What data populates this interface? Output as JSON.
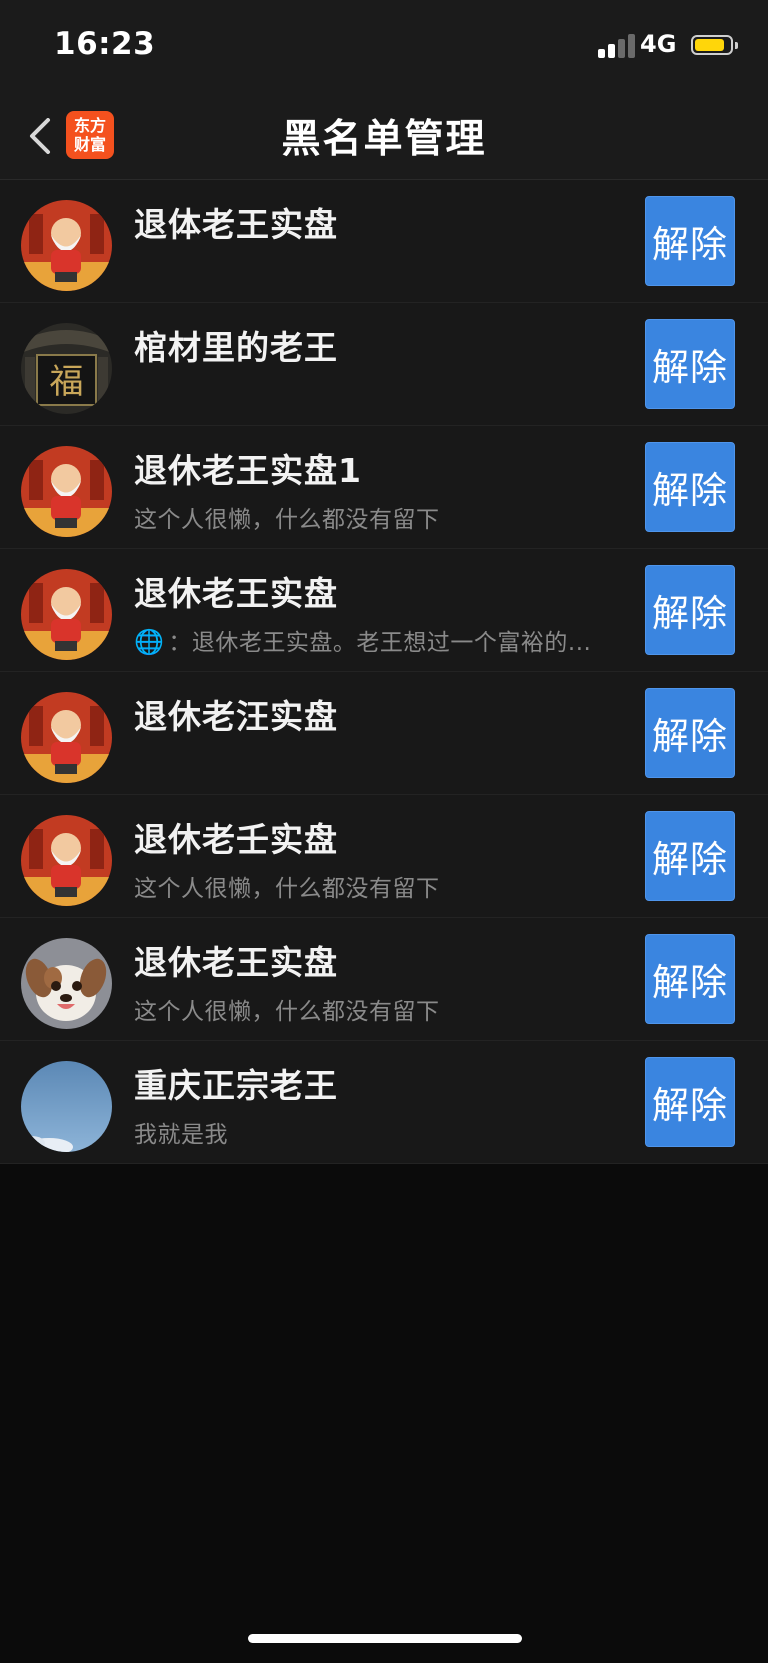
{
  "status_bar": {
    "time": "16:23",
    "network": "4G",
    "signal_bars_active": 2,
    "signal_bars_total": 4,
    "battery_level": 0.85,
    "battery_color": "#ffd60a"
  },
  "nav": {
    "back_icon": "chevron-left-icon",
    "logo_line1": "东方",
    "logo_line2": "财富",
    "logo_color": "#f4511e",
    "title": "黑名单管理"
  },
  "list": {
    "button_color": "#3a85e0",
    "items": [
      {
        "name": "退体老王实盘",
        "bio": "",
        "avatar": "old-man-avatar",
        "unblock_label": "解除"
      },
      {
        "name": "棺材里的老王",
        "bio": "",
        "avatar": "fu-plaque-avatar",
        "unblock_label": "解除"
      },
      {
        "name": "退休老王实盘1",
        "bio": "这个人很懒，什么都没有留下",
        "avatar": "old-man-avatar",
        "unblock_label": "解除"
      },
      {
        "name": "退休老王实盘",
        "bio": "：退休老王实盘。老王想过一个富裕的...",
        "bio_icon": "globe-icon",
        "avatar": "old-man-avatar",
        "unblock_label": "解除"
      },
      {
        "name": "退休老汪实盘",
        "bio": "",
        "avatar": "old-man-avatar",
        "unblock_label": "解除"
      },
      {
        "name": "退休老壬实盘",
        "bio": "这个人很懒，什么都没有留下",
        "avatar": "old-man-avatar",
        "unblock_label": "解除"
      },
      {
        "name": "退休老王实盘",
        "bio": "这个人很懒，什么都没有留下",
        "avatar": "puppy-avatar",
        "unblock_label": "解除"
      },
      {
        "name": "重庆正宗老王",
        "bio": "我就是我",
        "avatar": "sky-avatar",
        "unblock_label": "解除"
      }
    ]
  }
}
